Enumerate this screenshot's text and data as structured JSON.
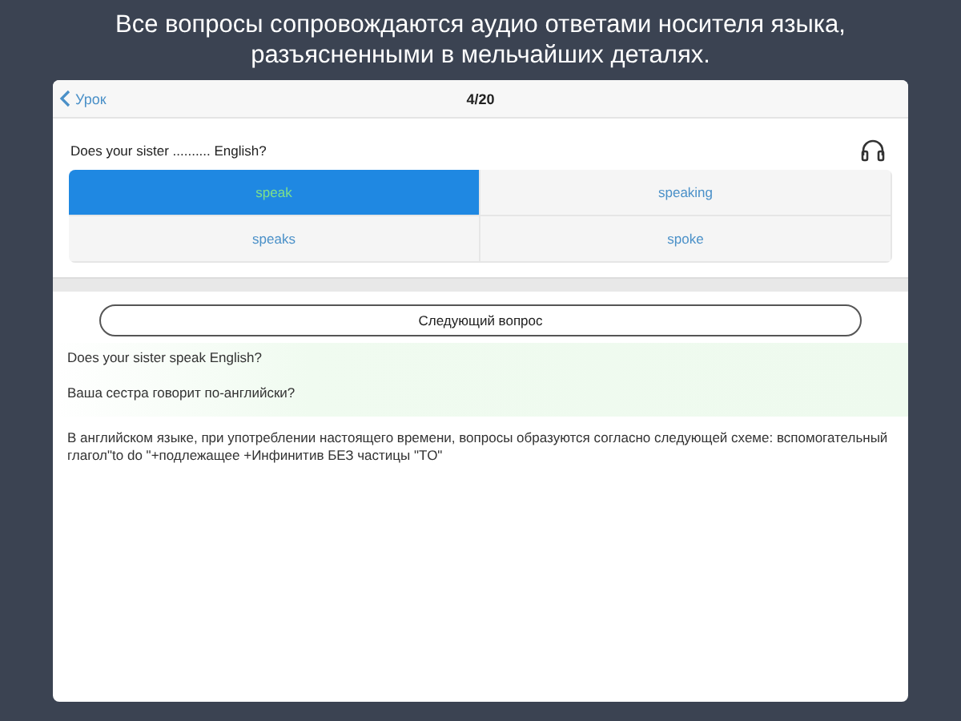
{
  "headline": "Все вопросы сопровождаются аудио ответами носителя языка, разъясненными в мельчайших деталях.",
  "nav": {
    "back": "Урок",
    "progress": "4/20"
  },
  "question": "Does your sister .......... English?",
  "options": [
    {
      "label": "speak",
      "selected": true
    },
    {
      "label": "speaking",
      "selected": false
    },
    {
      "label": "speaks",
      "selected": false
    },
    {
      "label": "spoke",
      "selected": false
    }
  ],
  "next_button": "Следующий вопрос",
  "answer": {
    "english": "Does your sister speak English?",
    "translation": "Ваша сестра говорит по-английски?"
  },
  "explanation": "В английском языке, при употреблении настоящего времени, вопросы образуются согласно следующей схеме: вспомогательный глагол\"to do \"+подлежащее +Инфинитив БЕЗ частицы \"TO\""
}
